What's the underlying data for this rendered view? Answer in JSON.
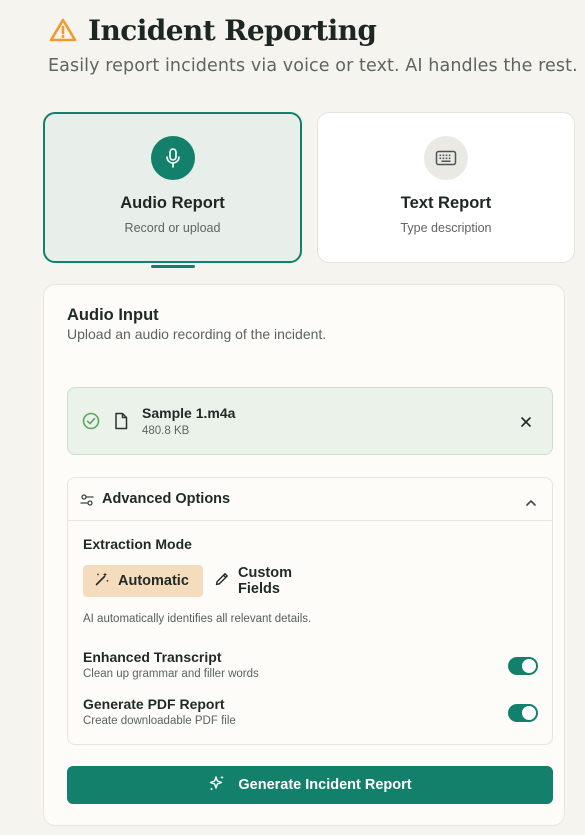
{
  "header": {
    "title": "Incident Reporting",
    "subtitle": "Easily report incidents via voice or text. AI handles the rest.",
    "icon": "warning-triangle-icon",
    "icon_color": "#f29a2e"
  },
  "modes": [
    {
      "label": "Audio Report",
      "desc": "Record or upload",
      "icon": "microphone-icon",
      "selected": true
    },
    {
      "label": "Text Report",
      "desc": "Type description",
      "icon": "keyboard-icon",
      "selected": false
    }
  ],
  "audio_input": {
    "title": "Audio Input",
    "subtitle": "Upload an audio recording of the incident.",
    "file": {
      "name": "Sample 1.m4a",
      "size": "480.8 KB"
    }
  },
  "advanced": {
    "title": "Advanced Options",
    "expanded": true,
    "extraction_label": "Extraction Mode",
    "options": [
      {
        "label": "Automatic",
        "icon": "magic-wand-icon",
        "selected": true
      },
      {
        "label": "Custom Fields",
        "icon": "pencil-icon",
        "selected": false
      }
    ],
    "note": "AI automatically identifies all relevant details.",
    "toggles": [
      {
        "title": "Enhanced Transcript",
        "desc": "Clean up grammar and filler words",
        "on": true
      },
      {
        "title": "Generate PDF Report",
        "desc": "Create downloadable PDF file",
        "on": true
      }
    ]
  },
  "generate_button": {
    "label": "Generate Incident Report",
    "icon": "sparkles-icon"
  },
  "colors": {
    "accent": "#12806a",
    "background": "#f6f4ef",
    "selected_option": "#f4dcbd",
    "success": "#5aa860"
  }
}
